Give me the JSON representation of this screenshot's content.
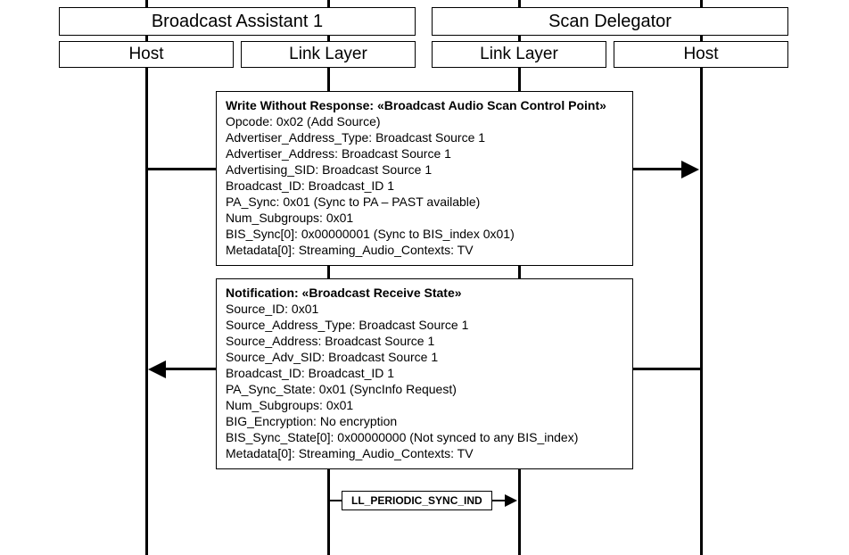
{
  "actors": {
    "broadcast_assistant": "Broadcast Assistant 1",
    "scan_delegator": "Scan Delegator",
    "host_left": "Host",
    "link_layer_left": "Link Layer",
    "link_layer_right": "Link Layer",
    "host_right": "Host"
  },
  "msg1": {
    "title": "Write Without Response: «Broadcast Audio Scan Control Point»",
    "l1": "Opcode: 0x02 (Add Source)",
    "l2": "Advertiser_Address_Type: Broadcast Source 1",
    "l3": "Advertiser_Address: Broadcast Source 1",
    "l4": "Advertising_SID: Broadcast Source 1",
    "l5": "Broadcast_ID: Broadcast_ID 1",
    "l6": "PA_Sync: 0x01 (Sync to PA – PAST available)",
    "l7": "Num_Subgroups: 0x01",
    "l8": "BIS_Sync[0]: 0x00000001 (Sync to BIS_index 0x01)",
    "l9": "Metadata[0]: Streaming_Audio_Contexts: TV"
  },
  "msg2": {
    "title": "Notification: «Broadcast Receive State»",
    "l1": "Source_ID: 0x01",
    "l2": "Source_Address_Type: Broadcast Source 1",
    "l3": "Source_Address: Broadcast Source 1",
    "l4": "Source_Adv_SID: Broadcast Source 1",
    "l5": "Broadcast_ID: Broadcast_ID 1",
    "l6": "PA_Sync_State: 0x01 (SyncInfo Request)",
    "l7": "Num_Subgroups: 0x01",
    "l8": "BIG_Encryption: No encryption",
    "l9": "BIS_Sync_State[0]: 0x00000000 (Not synced to any BIS_index)",
    "l10": "Metadata[0]: Streaming_Audio_Contexts: TV"
  },
  "msg3": {
    "label": "LL_PERIODIC_SYNC_IND"
  }
}
